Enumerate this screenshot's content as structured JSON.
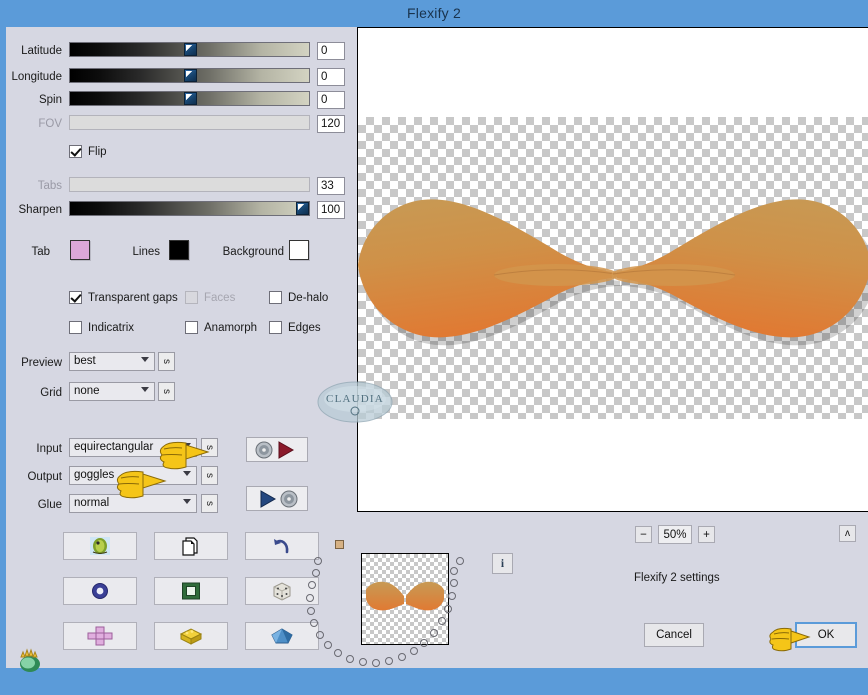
{
  "window": {
    "title": "Flexify 2",
    "titlebar_color": "#5b9bd9",
    "panel_color": "#d6d7e2"
  },
  "sliders": [
    {
      "label": "Latitude",
      "value": "0",
      "percent": 50,
      "disabled": false
    },
    {
      "label": "Longitude",
      "value": "0",
      "percent": 50,
      "disabled": false
    },
    {
      "label": "Spin",
      "value": "0",
      "percent": 50,
      "disabled": false
    },
    {
      "label": "FOV",
      "value": "120",
      "percent": 0,
      "disabled": true
    }
  ],
  "flip": {
    "label": "Flip",
    "checked": true
  },
  "sliders2": [
    {
      "label": "Tabs",
      "value": "33",
      "percent": 0,
      "disabled": true
    },
    {
      "label": "Sharpen",
      "value": "100",
      "percent": 97,
      "disabled": false
    }
  ],
  "swatches": [
    {
      "label": "Tab",
      "color": "#dda8da"
    },
    {
      "label": "Lines",
      "color": "#000000"
    },
    {
      "label": "Background",
      "color": "#ffffff"
    }
  ],
  "checkboxes": [
    {
      "label": "Transparent gaps",
      "checked": true,
      "disabled": false
    },
    {
      "label": "Faces",
      "checked": false,
      "disabled": true
    },
    {
      "label": "De-halo",
      "checked": false,
      "disabled": false
    },
    {
      "label": "Indicatrix",
      "checked": false,
      "disabled": false
    },
    {
      "label": "Anamorph",
      "checked": false,
      "disabled": false
    },
    {
      "label": "Edges",
      "checked": false,
      "disabled": false
    }
  ],
  "selects": [
    {
      "label": "Preview",
      "value": "best",
      "side_button": "s"
    },
    {
      "label": "Grid",
      "value": "none",
      "side_button": "s"
    },
    {
      "label": "Input",
      "value": "equirectangular",
      "side_button": "s"
    },
    {
      "label": "Output",
      "value": "goggles",
      "side_button": "s"
    },
    {
      "label": "Glue",
      "value": "normal",
      "side_button": "s"
    }
  ],
  "transfer_buttons": [
    {
      "name": "load-settings-button",
      "icon": "disc-to-play-icon"
    },
    {
      "name": "save-settings-button",
      "icon": "play-to-disc-icon"
    }
  ],
  "icon_grid": [
    {
      "name": "photo-button",
      "icon": "photo-icon"
    },
    {
      "name": "copy-button",
      "icon": "pages-icon"
    },
    {
      "name": "undo-button",
      "icon": "undo-arrow-icon"
    },
    {
      "name": "ring-button",
      "icon": "blue-ring-icon"
    },
    {
      "name": "square-button",
      "icon": "green-square-icon"
    },
    {
      "name": "dice-button",
      "icon": "dice-icon"
    },
    {
      "name": "cross-button",
      "icon": "pink-cross-icon"
    },
    {
      "name": "cube-button",
      "icon": "yellow-cube-icon"
    },
    {
      "name": "polyhedron-button",
      "icon": "blue-polyhedron-icon"
    }
  ],
  "corner_icon": {
    "name": "green-hand-icon"
  },
  "info_button": {
    "label": "i"
  },
  "zoom": {
    "minus": "−",
    "level": "50%",
    "plus": "+"
  },
  "collapse_button": {
    "label": "ʌ"
  },
  "status": {
    "text": "Flexify 2 settings"
  },
  "footer": {
    "cancel": "Cancel",
    "ok": "OK"
  },
  "watermark": {
    "text": "CLAUDIA"
  },
  "preview": {
    "alt": "orange bow-tie goggles projection on transparent checkerboard"
  }
}
